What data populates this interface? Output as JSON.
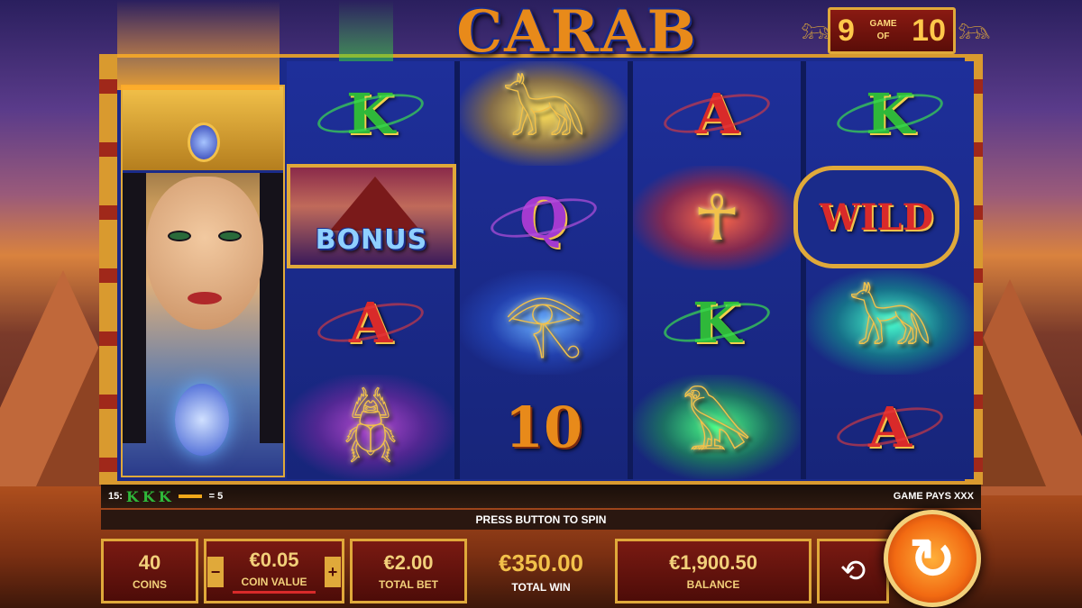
{
  "logo": {
    "text": "CARAB"
  },
  "game_counter": {
    "current": "9",
    "top_label": "GAME",
    "mid_label": "OF",
    "total": "10"
  },
  "reels": [
    [
      {
        "symbol": "K"
      },
      {
        "symbol": "bonus",
        "label": "BONUS"
      },
      {
        "symbol": "A"
      },
      {
        "symbol": "amulet-purple"
      }
    ],
    [
      {
        "symbol": "amulet-yellow"
      },
      {
        "symbol": "Q"
      },
      {
        "symbol": "amulet-blue"
      },
      {
        "symbol": "10"
      }
    ],
    [
      {
        "symbol": "A"
      },
      {
        "symbol": "amulet-red"
      },
      {
        "symbol": "K"
      },
      {
        "symbol": "amulet-green"
      }
    ],
    [
      {
        "symbol": "K"
      },
      {
        "symbol": "wild",
        "label": "WILD"
      },
      {
        "symbol": "amulet-teal"
      },
      {
        "symbol": "A"
      }
    ]
  ],
  "paytable": {
    "line": "15:",
    "symbols": [
      "K",
      "K",
      "K"
    ],
    "equals": "= 5",
    "right": "GAME PAYS XXX"
  },
  "prompt": "PRESS BUTTON TO SPIN",
  "panels": {
    "coins": {
      "value": "40",
      "label": "COINS"
    },
    "coin_value": {
      "value": "€0.05",
      "label": "COIN VALUE",
      "minus": "−",
      "plus": "+"
    },
    "total_bet": {
      "value": "€2.00",
      "label": "TOTAL BET"
    },
    "total_win": {
      "value": "€350.00",
      "label": "TOTAL WIN"
    },
    "balance": {
      "value": "€1,900.50",
      "label": "BALANCE"
    }
  },
  "icons": {
    "autoplay": "autoplay-icon",
    "spin": "spin-icon"
  },
  "colors": {
    "frame_gold": "#e0a93a",
    "panel_red": "#7a1a12",
    "reel_blue": "#1b2a8a"
  }
}
